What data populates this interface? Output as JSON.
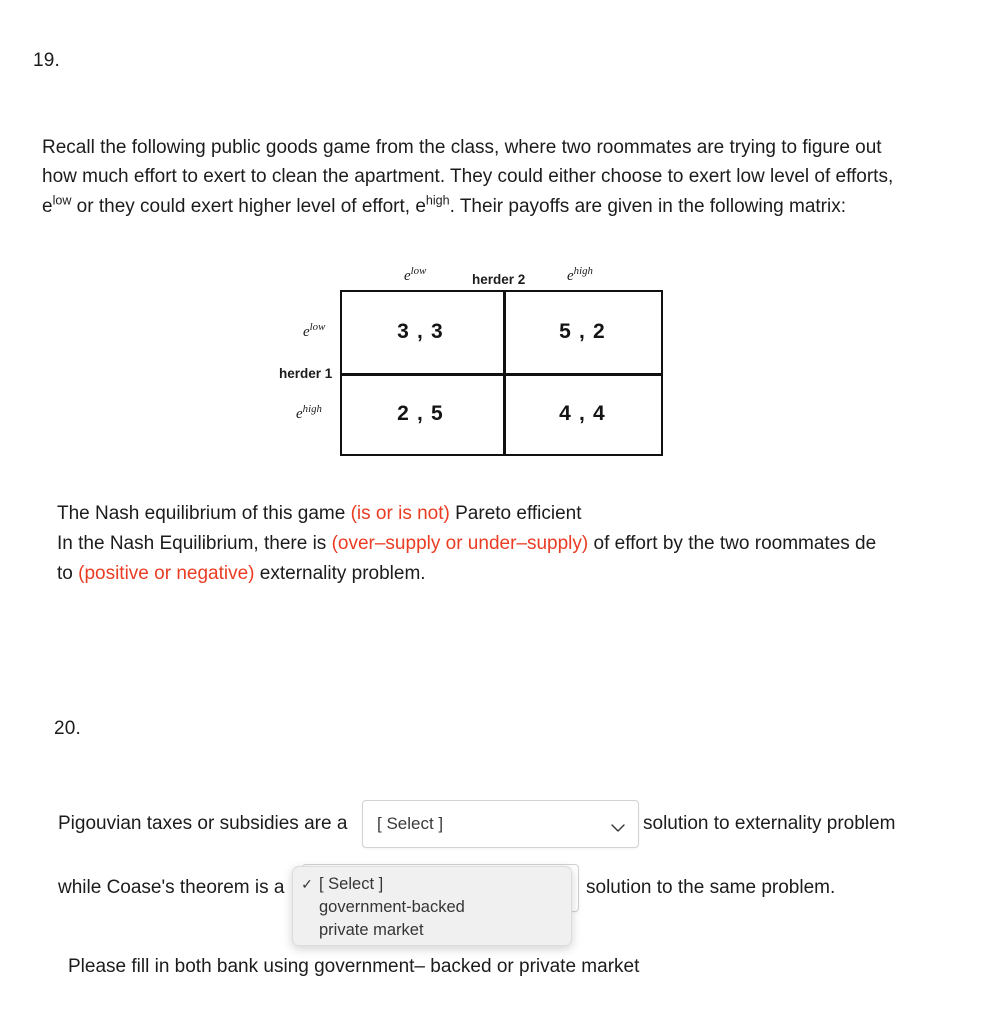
{
  "question19": {
    "number": "19.",
    "intro_parts": {
      "p1": "Recall the following public goods game from the class, where two roommates are trying to figure out how much effort to exert to clean the apartment. They could either choose to exert low level of efforts, e",
      "sup1": "low",
      "p2": " or they could exert higher level of effort, e",
      "sup2": "high",
      "p3": ". Their payoffs are given in the following matrix:"
    },
    "matrix": {
      "player_row_label": "herder 1",
      "player_col_label": "herder 2",
      "row_headers": [
        {
          "base": "e",
          "sup": "low"
        },
        {
          "base": "e",
          "sup": "high"
        }
      ],
      "col_headers": [
        {
          "base": "e",
          "sup": "low"
        },
        {
          "base": "e",
          "sup": "high"
        }
      ],
      "cells": [
        [
          "3 , 3",
          "5 , 2"
        ],
        [
          "2 , 5",
          "4 , 4"
        ]
      ]
    },
    "statements": {
      "s1_pre": "The Nash equilibrium of this game ",
      "s1_blank": "(is or is not)",
      "s1_post": " Pareto efficient",
      "s2_pre": " In the Nash Equilibrium, there is ",
      "s2_blank": "(over–supply or under–supply)",
      "s2_post": " of effort by the two roommates de to ",
      "s3_blank": "(positive or negative)",
      "s3_post": " externality problem."
    },
    "blank_color": "#ea3c23"
  },
  "question20": {
    "number": "20.",
    "line1_pre": "Pigouvian taxes or subsidies are a",
    "line1_post": "solution to externality problem",
    "line2_pre": "while Coase's theorem  is a",
    "line2_post": "solution to the same problem.",
    "footnote": "Please fill in both bank using government– backed or private market",
    "select1": {
      "value": "[ Select ]",
      "chevron": "chevron-down-icon"
    },
    "select2": {
      "value": "[ Select ]",
      "chevron": "chevron-down-icon"
    },
    "dropdown": {
      "options": [
        {
          "label": "[ Select ]",
          "checked": true,
          "check_glyph": "✓"
        },
        {
          "label": "government-backed",
          "checked": false,
          "check_glyph": ""
        },
        {
          "label": "private market",
          "checked": false,
          "check_glyph": ""
        }
      ]
    }
  }
}
